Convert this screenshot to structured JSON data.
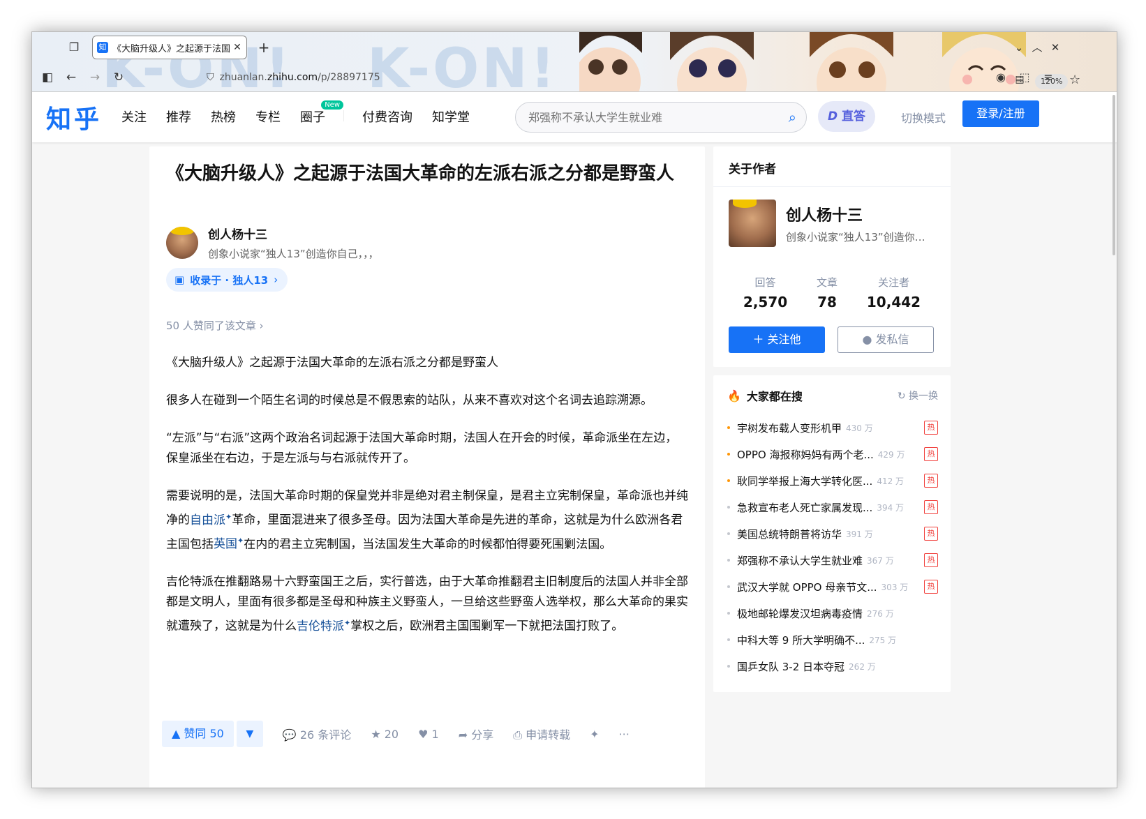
{
  "browser": {
    "tab_title": "《大脑升级人》之起源于法国",
    "url_host_prefix": "zhuanlan.",
    "url_host": "zhihu.com",
    "url_path": "/p/28897175",
    "zoom": "120%",
    "deco_text_1": "K-ON!",
    "deco_text_2": "K-ON!"
  },
  "header": {
    "logo": "知乎",
    "nav": [
      "关注",
      "推荐",
      "热榜",
      "专栏",
      "圈子",
      "付费咨询",
      "知学堂"
    ],
    "new_badge": "New",
    "search_placeholder": "郑强称不承认大学生就业难",
    "zhida": "直答",
    "switch_mode": "切换模式",
    "login": "登录/注册"
  },
  "article": {
    "title": "《大脑升级人》之起源于法国大革命的左派右派之分都是野蛮人",
    "author_name": "创人杨十三",
    "author_bio": "创象小说家“独人13”创造你自己，，，",
    "collection": "收录于 · 独人13",
    "voters": "50 人赞同了该文章",
    "paragraphs": {
      "p1": "《大脑升级人》之起源于法国大革命的左派右派之分都是野蛮人",
      "p2": "很多人在碰到一个陌生名词的时候总是不假思索的站队，从来不喜欢对这个名词去追踪溯源。",
      "p3": "“左派”与“右派”这两个政治名词起源于法国大革命时期，法国人在开会的时候，革命派坐在左边，保皇派坐在右边，于是左派与与右派就传开了。",
      "p4a": "需要说明的是，法国大革命时期的保皇党并非是绝对君主制保皇，是君主立宪制保皇，革命派也并纯净的",
      "p4_link1": "自由派",
      "p4b": "革命，里面混进来了很多圣母。因为法国大革命是先进的革命，这就是为什么欧洲各君主国包括",
      "p4_link2": "英国",
      "p4c": "在内的君主立宪制国，当法国发生大革命的时候都怕得要死围剿法国。",
      "p5a": "吉伦特派在推翻路易十六野蛮国王之后，实行普选，由于大革命推翻君主旧制度后的法国人并非全部都是文明人，里面有很多都是圣母和种族主义野蛮人，一旦给这些野蛮人选举权，那么大革命的果实就遭殃了，这就是为什么",
      "p5_link": "吉伦特派",
      "p5b": "掌权之后，欧洲君主国围剿军一下就把法国打败了。"
    },
    "link_mark": "✦",
    "actions": {
      "vote_up": "▲ 赞同 50",
      "vote_down": "▼",
      "comments": "26 条评论",
      "favorites": "20",
      "likes": "1",
      "share": "分享",
      "reprint": "申请转载",
      "more": "···"
    }
  },
  "about": {
    "title": "关于作者",
    "name": "创人杨十三",
    "bio": "创象小说家“独人13”创造你自己，，，",
    "stats": [
      {
        "label": "回答",
        "value": "2,570"
      },
      {
        "label": "文章",
        "value": "78"
      },
      {
        "label": "关注者",
        "value": "10,442"
      }
    ],
    "follow": "＋ 关注他",
    "message": "发私信"
  },
  "hot": {
    "title": "大家都在搜",
    "refresh": "换一换",
    "badge": "热",
    "items": [
      {
        "text": "宇树发布载人变形机甲",
        "heat": "430 万",
        "hot": true
      },
      {
        "text": "OPPO 海报称妈妈有两个老...",
        "heat": "429 万",
        "hot": true
      },
      {
        "text": "耿同学举报上海大学转化医...",
        "heat": "412 万",
        "hot": true
      },
      {
        "text": "急救宣布老人死亡家属发现...",
        "heat": "394 万",
        "hot": true
      },
      {
        "text": "美国总统特朗普将访华",
        "heat": "391 万",
        "hot": true
      },
      {
        "text": "郑强称不承认大学生就业难",
        "heat": "367 万",
        "hot": true
      },
      {
        "text": "武汉大学就 OPPO 母亲节文...",
        "heat": "303 万",
        "hot": true
      },
      {
        "text": "极地邮轮爆发汉坦病毒疫情",
        "heat": "276 万",
        "hot": false
      },
      {
        "text": "中科大等 9 所大学明确不...",
        "heat": "275 万",
        "hot": false
      },
      {
        "text": "国乒女队 3-2 日本夺冠",
        "heat": "262 万",
        "hot": false
      }
    ]
  },
  "colors": {
    "brand": "#1772f6",
    "hot": "#f1403c"
  }
}
